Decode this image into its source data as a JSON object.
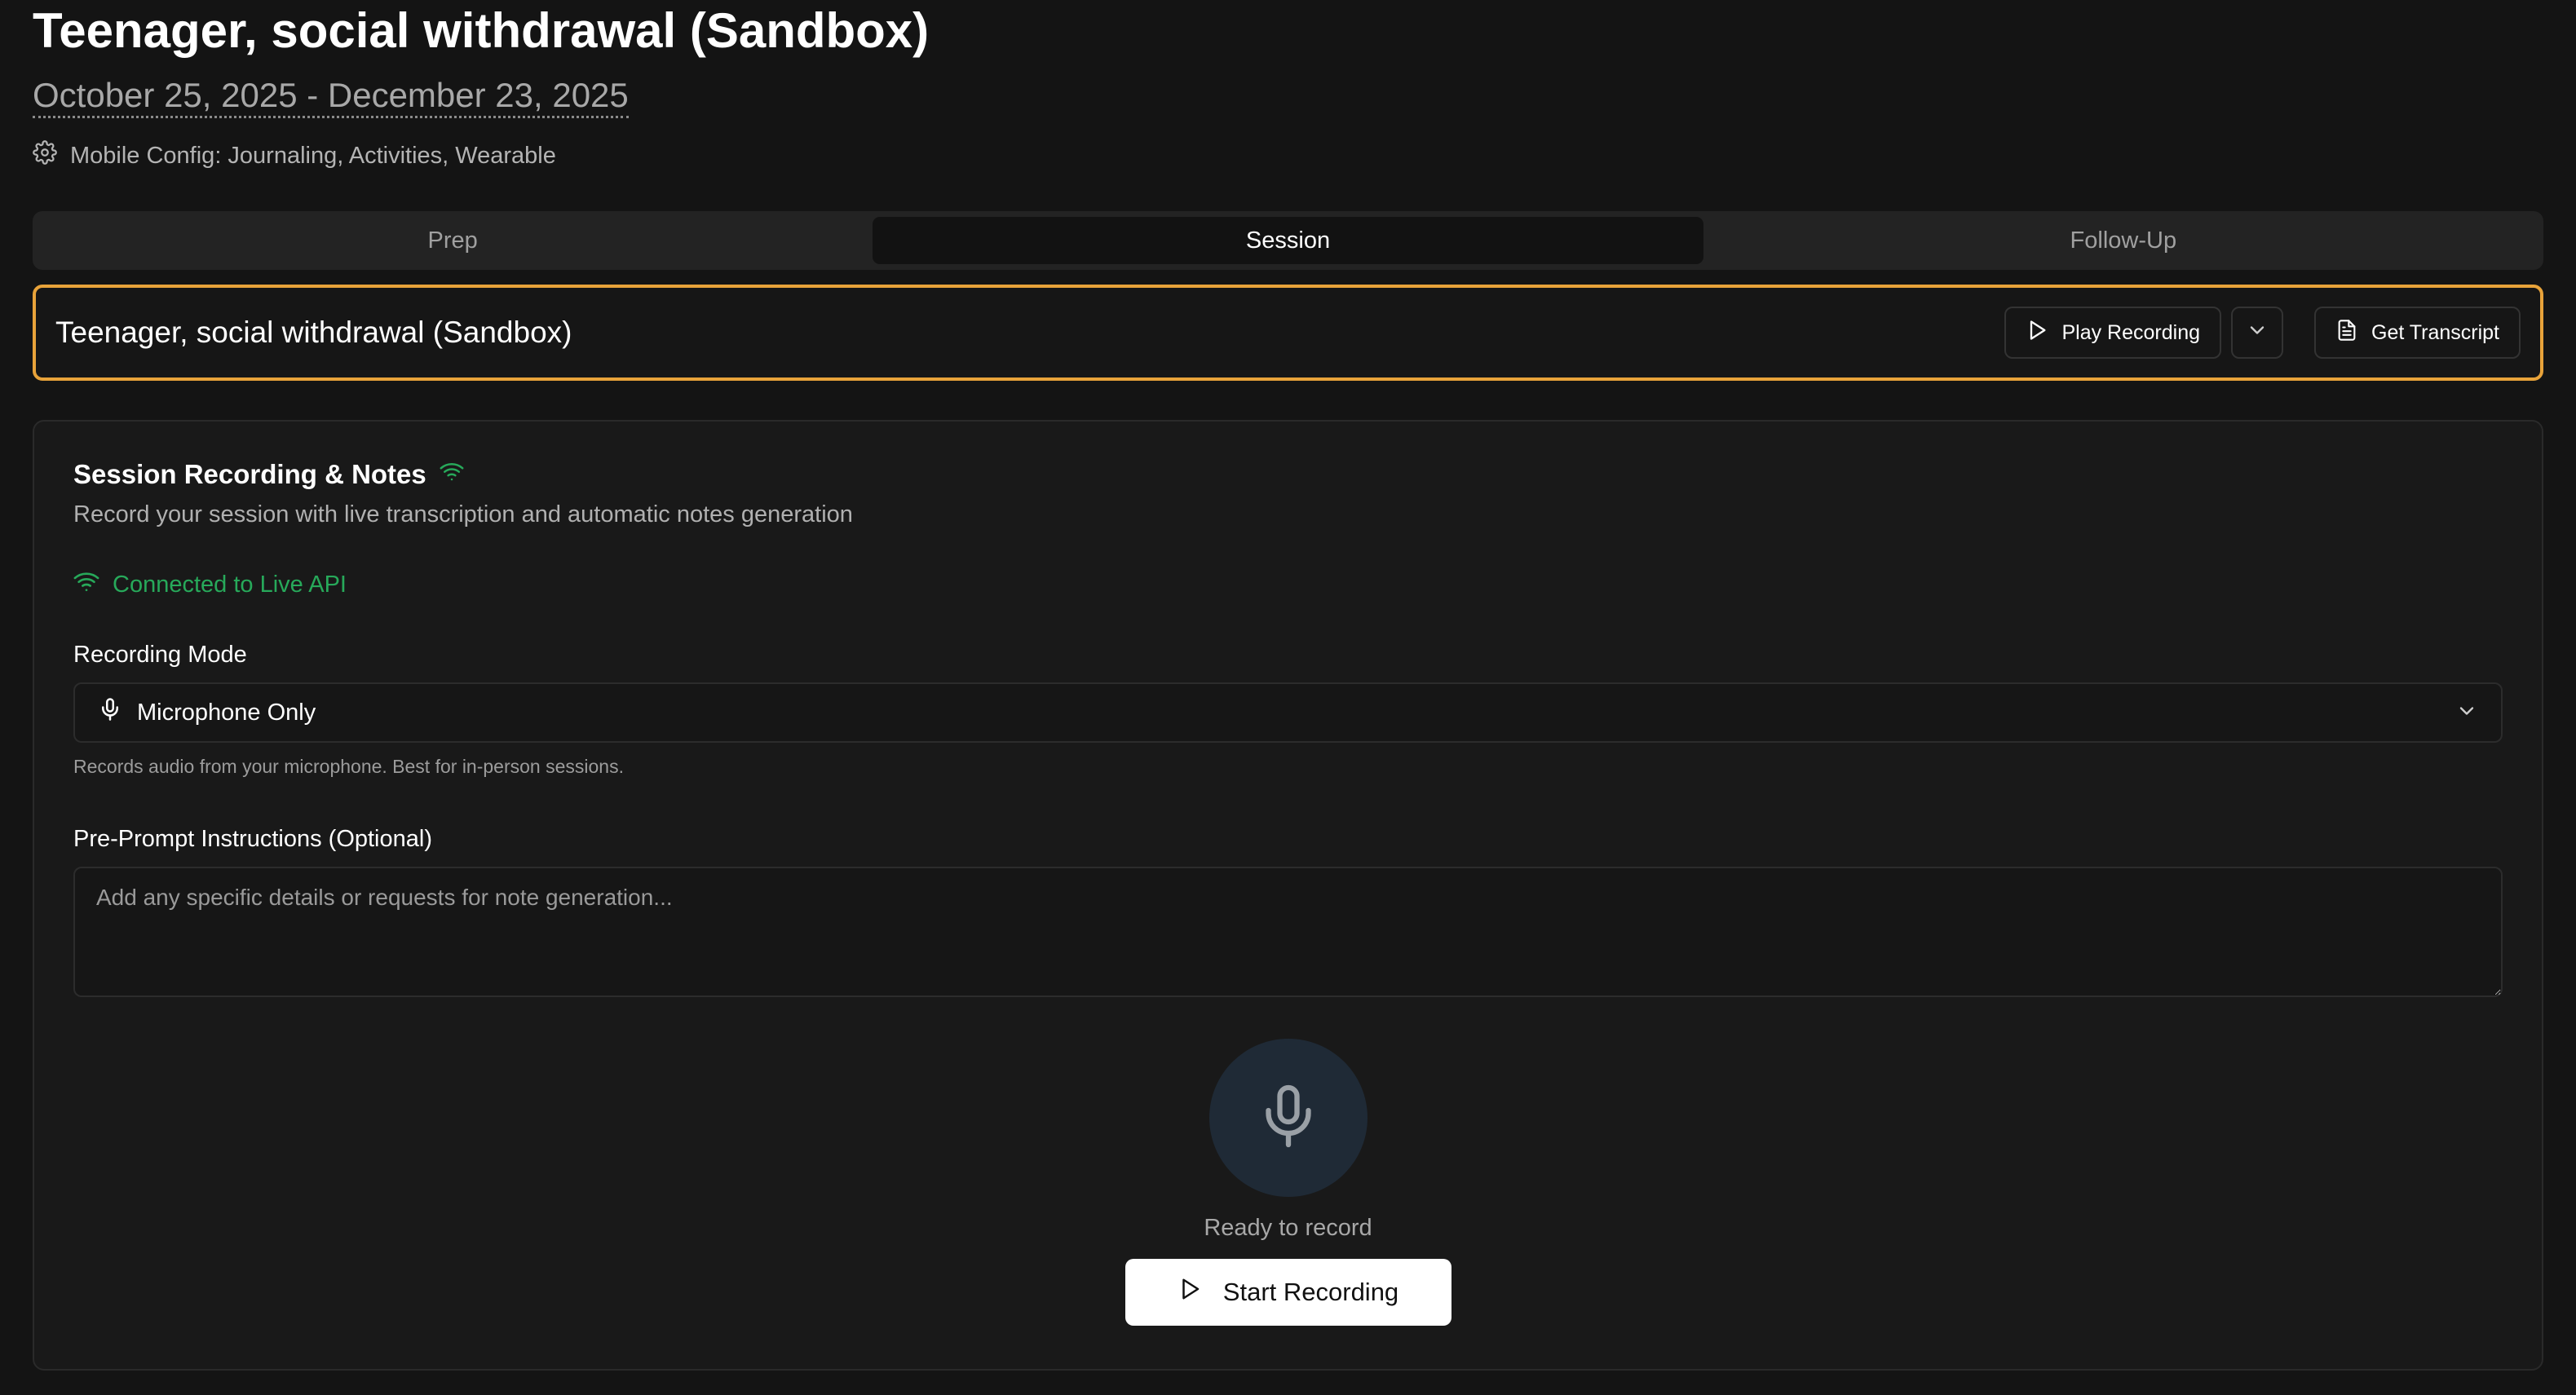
{
  "header": {
    "title": "Teenager, social withdrawal (Sandbox)",
    "date_range": "October 25, 2025 - December 23, 2025",
    "config_text": "Mobile Config: Journaling, Activities, Wearable"
  },
  "tabs": [
    {
      "label": "Prep",
      "active": false
    },
    {
      "label": "Session",
      "active": true
    },
    {
      "label": "Follow-Up",
      "active": false
    }
  ],
  "session_bar": {
    "title": "Teenager, social withdrawal (Sandbox)",
    "play_label": "Play Recording",
    "transcript_label": "Get Transcript",
    "accent_color": "#e8a33a"
  },
  "card": {
    "title": "Session Recording & Notes",
    "subtitle": "Record your session with live transcription and automatic notes generation",
    "connection_status": "Connected to Live API",
    "status_color": "#27a95a",
    "recording_mode_label": "Recording Mode",
    "recording_mode_value": "Microphone Only",
    "recording_mode_helper": "Records audio from your microphone. Best for in-person sessions.",
    "preprompt_label": "Pre-Prompt Instructions (Optional)",
    "preprompt_placeholder": "Add any specific details or requests for note generation...",
    "ready_text": "Ready to record",
    "start_label": "Start Recording"
  },
  "icons": {
    "config": "gear-icon",
    "wifi": "wifi-icon",
    "play": "play-icon",
    "chevron": "chevron-down-icon",
    "document": "document-icon",
    "mic": "microphone-icon"
  }
}
